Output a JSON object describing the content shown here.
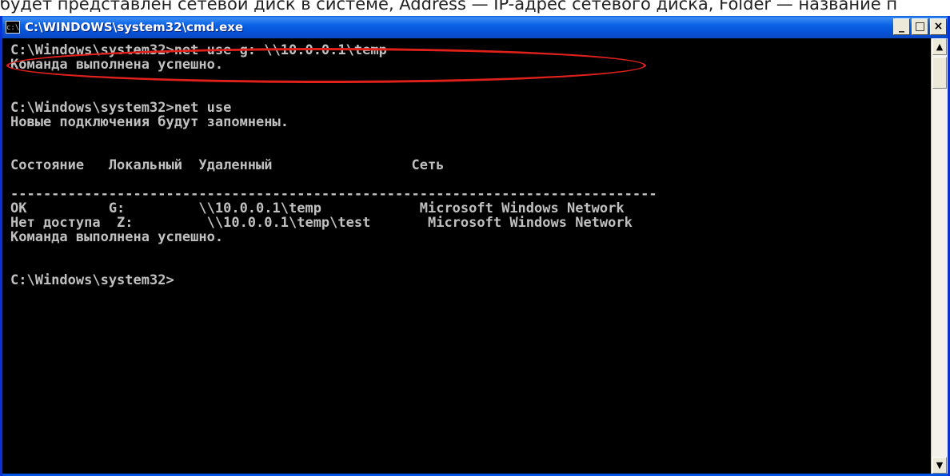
{
  "caption": "будет представлен сетевой диск в системе, Address — IP-адрес сетевого диска, Folder — название п",
  "window": {
    "title": "C:\\WINDOWS\\system32\\cmd.exe",
    "icon_label": "c:\\",
    "buttons": {
      "minimize": "_",
      "maximize": "□",
      "close": "×"
    }
  },
  "console": {
    "lines": [
      "C:\\Windows\\system32>net use g: \\\\10.0.0.1\\temp",
      "Команда выполнена успешно.",
      "",
      "",
      "C:\\Windows\\system32>net use",
      "Новые подключения будут запомнены.",
      "",
      "",
      "Состояние   Локальный  Удаленный                 Сеть",
      "",
      "-------------------------------------------------------------------------------",
      "OK          G:         \\\\10.0.0.1\\temp            Microsoft Windows Network",
      "Нет доступа  Z:         \\\\10.0.0.1\\temp\\test       Microsoft Windows Network",
      "Команда выполнена успешно.",
      "",
      "",
      "C:\\Windows\\system32>"
    ]
  },
  "scrollbar": {
    "up_arrow": "▲",
    "down_arrow": "▼"
  },
  "annotation_color": "#e0201b"
}
